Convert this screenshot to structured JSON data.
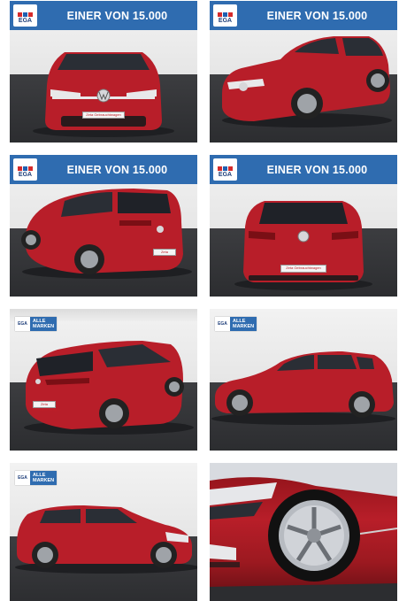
{
  "gallery": {
    "banner_text": "EINER VON 15.000",
    "logo_text": "EGA",
    "badge_line1": "ALLE",
    "badge_line2": "MARKEN",
    "plate_text": "Zeta Gebrauchtwagen",
    "photos": [
      {
        "view": "front",
        "banner": true
      },
      {
        "view": "front-right",
        "banner": true
      },
      {
        "view": "rear-left",
        "banner": true
      },
      {
        "view": "rear",
        "banner": true
      },
      {
        "view": "rear-left-interior",
        "banner": false
      },
      {
        "view": "left-side",
        "banner": false
      },
      {
        "view": "left-side-front",
        "banner": false
      },
      {
        "view": "wheel-detail",
        "banner": false
      }
    ]
  },
  "colors": {
    "banner_blue": "#2f6cb0",
    "car_red": "#c0202a",
    "flag_red": "#d62b2b",
    "flag_blue": "#1f5fb0"
  }
}
